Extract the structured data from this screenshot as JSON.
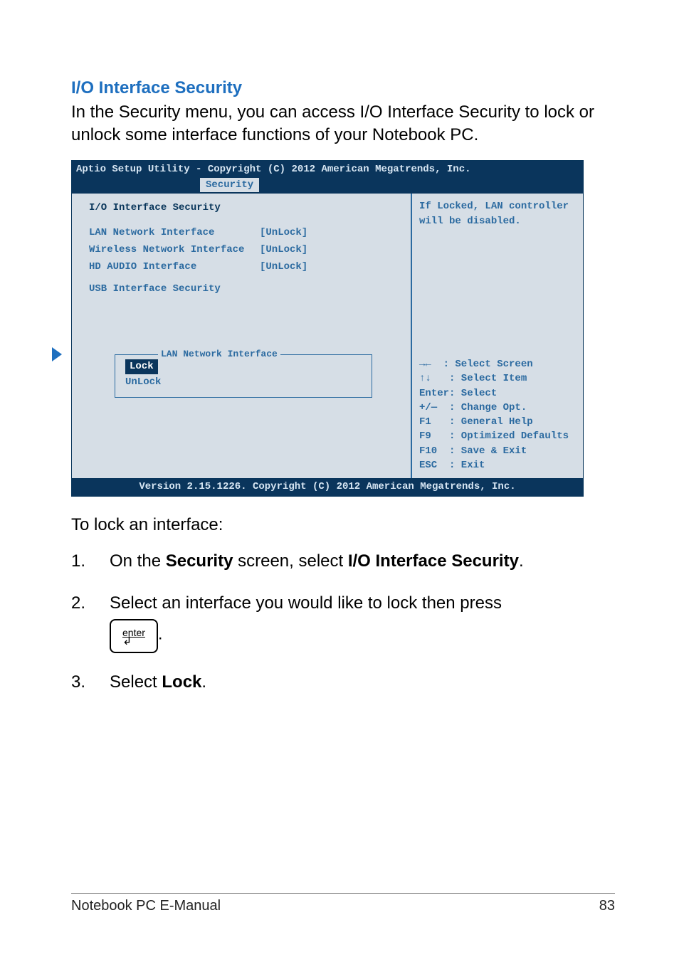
{
  "heading": "I/O Interface Security",
  "intro": "In the Security menu, you can access I/O Interface Security to lock or unlock some interface functions of your Notebook PC.",
  "bios": {
    "header": "Aptio Setup Utility - Copyright (C) 2012 American Megatrends, Inc.",
    "tab_active": "Security",
    "title": "I/O Interface Security",
    "rows": [
      {
        "label": "LAN Network Interface",
        "value": "[UnLock]"
      },
      {
        "label": "Wireless Network Interface",
        "value": "[UnLock]"
      },
      {
        "label": "HD AUDIO Interface",
        "value": "[UnLock]"
      }
    ],
    "submenu": "USB Interface Security",
    "popup": {
      "title": "LAN Network Interface",
      "selected": "Lock",
      "items": [
        "Lock",
        "UnLock"
      ]
    },
    "right_top": "If Locked, LAN controller will be disabled.",
    "right_help": "→←  : Select Screen\n↑↓   : Select Item\nEnter: Select\n+/—  : Change Opt.\nF1   : General Help\nF9   : Optimized Defaults\nF10  : Save & Exit\nESC  : Exit",
    "footer": "Version 2.15.1226. Copyright (C) 2012 American Megatrends, Inc."
  },
  "lock_intro": "To lock an interface:",
  "steps": {
    "s1_num": "1.",
    "s1_a": "On the ",
    "s1_b": "Security",
    "s1_c": " screen, select ",
    "s1_d": "I/O Interface Security",
    "s1_e": ".",
    "s2_num": "2.",
    "s2_a": "Select an interface you would like to lock then press ",
    "enter_label": "enter",
    "s2_b": ".",
    "s3_num": "3.",
    "s3_a": "Select ",
    "s3_b": "Lock",
    "s3_c": "."
  },
  "footer_left": "Notebook PC E-Manual",
  "footer_right": "83"
}
